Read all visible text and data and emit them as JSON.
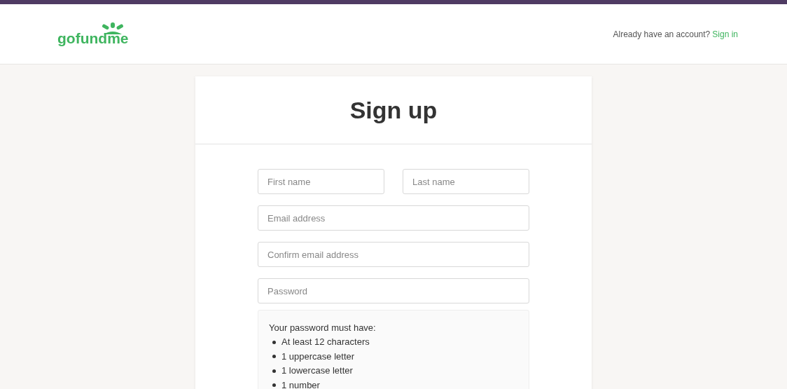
{
  "header": {
    "logo": "gofundme",
    "prompt": "Already have an account?",
    "sign_in_link": "Sign in"
  },
  "form": {
    "title": "Sign up",
    "fields": [
      {
        "placeholder": "First name",
        "half": true
      },
      {
        "placeholder": "Last name",
        "half": true
      },
      {
        "placeholder": "Email address",
        "half": false
      },
      {
        "placeholder": "Confirm email address",
        "half": false
      },
      {
        "placeholder": "Password",
        "half": false
      }
    ],
    "password_rules": {
      "heading": "Your password must have:",
      "items": [
        "At least 12 characters",
        "1 uppercase letter",
        "1 lowercase letter",
        "1 number"
      ]
    }
  }
}
